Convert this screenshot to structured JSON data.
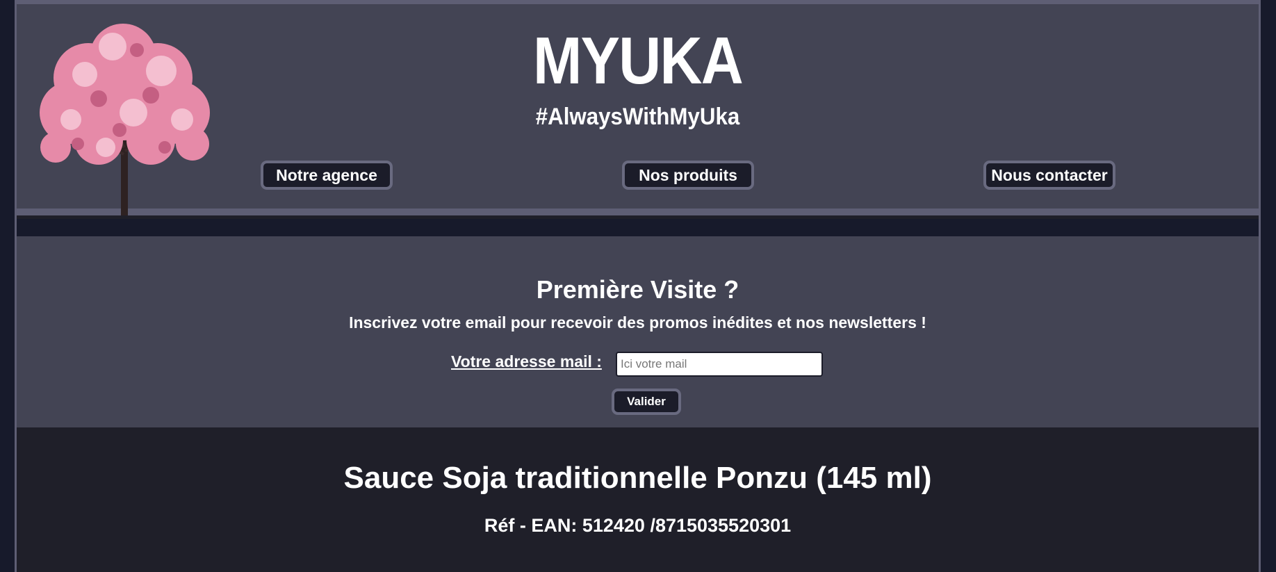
{
  "header": {
    "brand": "MYUKA",
    "tagline": "#AlwaysWithMyUka",
    "logo_icon": "cherry-blossom-tree-icon",
    "nav": {
      "agency": "Notre agence",
      "products": "Nos produits",
      "contact": "Nous contacter"
    }
  },
  "newsletter": {
    "title": "Première Visite ?",
    "subtitle": "Inscrivez votre email pour recevoir des promos inédites et nos newsletters !",
    "email_label": "Votre adresse mail :",
    "email_placeholder": "Ici votre mail",
    "email_value": "",
    "submit_label": "Valider"
  },
  "product": {
    "title": "Sauce Soja traditionnelle Ponzu (145 ml)",
    "ref": "Réf - EAN: 512420 /8715035520301"
  },
  "colors": {
    "page_bg": "#171a2b",
    "panel": "#434454",
    "border": "#5e5e74",
    "button": "#1b1c29",
    "content_bg": "#1f1f29",
    "blossom": "#e68aa8"
  }
}
